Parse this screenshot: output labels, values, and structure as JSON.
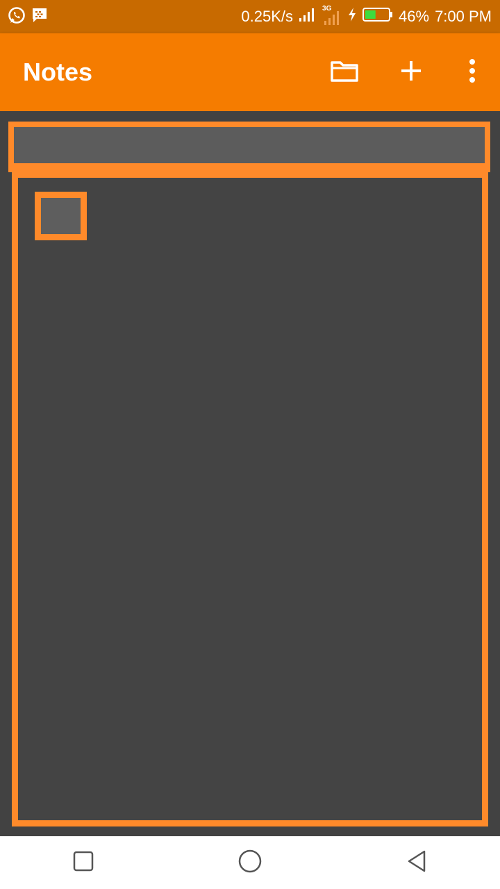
{
  "status_bar": {
    "left_icons": [
      "whatsapp-icon",
      "bbm-icon"
    ],
    "network_speed": "0.25K/s",
    "network_type": "3G",
    "battery_percent": "46%",
    "battery_level": 0.46,
    "time": "7:00 PM"
  },
  "app_bar": {
    "title": "Notes",
    "actions": [
      "folder-icon",
      "add-icon",
      "more-vert-icon"
    ]
  },
  "navigation_bar": {
    "buttons": [
      "recents-square-icon",
      "home-circle-icon",
      "back-triangle-icon"
    ]
  },
  "colors": {
    "status_bar": "#c86a00",
    "app_bar": "#f57c00",
    "highlight_border": "#ff8a2a",
    "background": "#424242",
    "field_fill": "#5c5c5c",
    "battery_fill": "#3ddc3d"
  }
}
